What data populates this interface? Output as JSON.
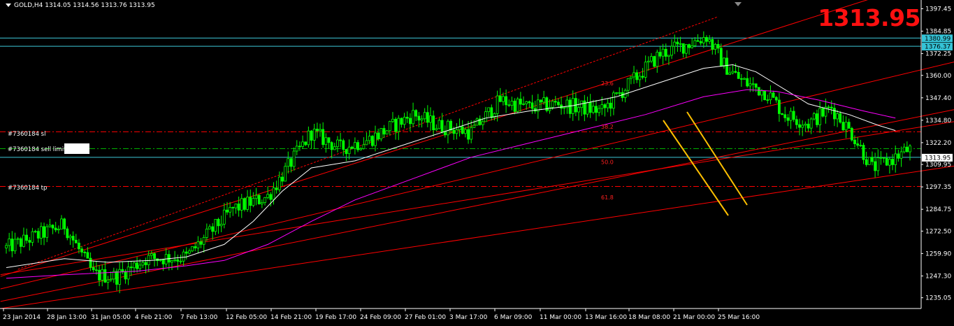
{
  "header": {
    "symbol_text": "GOLD,H4  1314.05 1314.56 1313.76 1313.95",
    "big_price": "1313.95"
  },
  "orders": {
    "sl_label": "#7360184 sl",
    "sell_limit_label": "#7360184 sell limit",
    "tp_label": "#7360184 tp"
  },
  "colors": {
    "background": "#000000",
    "candle": "#00ff00",
    "ma_fast": "#ffffff",
    "ma_slow": "#ff00ff",
    "trend": "#ff0000",
    "channel": "#ffc000",
    "hline": "#3ec8d8",
    "price": "#ff1010"
  },
  "chart_data": {
    "type": "candlestick",
    "ylim": [
      1229.0,
      1400.0
    ],
    "y_ticks": [
      "1397.45",
      "1384.85",
      "1372.25",
      "1360.00",
      "1347.40",
      "1334.80",
      "1322.20",
      "1309.95",
      "1297.35",
      "1284.75",
      "1272.50",
      "1259.90",
      "1247.30",
      "1235.05"
    ],
    "x_ticks": [
      "23 Jan 2014",
      "28 Jan 13:00",
      "31 Jan 05:00",
      "4 Feb 21:00",
      "7 Feb 13:00",
      "12 Feb 05:00",
      "14 Feb 21:00",
      "19 Feb 17:00",
      "24 Feb 09:00",
      "27 Feb 01:00",
      "3 Mar 17:00",
      "6 Mar 09:00",
      "11 Mar 00:00",
      "13 Mar 16:00",
      "18 Mar 08:00",
      "21 Mar 00:00",
      "25 Mar 16:00"
    ],
    "price_boxes": [
      {
        "label": "1380.99",
        "value": 1380.99
      },
      {
        "label": "1376.37",
        "value": 1376.37
      },
      {
        "label": "1313.95",
        "value": 1313.95
      }
    ],
    "horizontal_lines": [
      {
        "name": "upper cyan",
        "value": 1380.99,
        "style": "solid"
      },
      {
        "name": "lower cyan",
        "value": 1376.37,
        "style": "solid"
      },
      {
        "name": "current price",
        "value": 1313.95,
        "style": "solid"
      },
      {
        "name": "sl",
        "value": 1328.3,
        "style": "dashdot"
      },
      {
        "name": "sell limit",
        "value": 1318.8,
        "style": "dashdot-green"
      },
      {
        "name": "tp",
        "value": 1297.6,
        "style": "dashdot"
      }
    ],
    "fib_levels": [
      {
        "label": "23.6",
        "value": 1355.6
      },
      {
        "label": "38.2",
        "value": 1331.3
      },
      {
        "label": "50.0",
        "value": 1311.3
      },
      {
        "label": "61.8",
        "value": 1291.5
      }
    ],
    "anchors": [
      [
        0,
        1263
      ],
      [
        20,
        1276
      ],
      [
        30,
        1248
      ],
      [
        38,
        1247
      ],
      [
        48,
        1257
      ],
      [
        62,
        1258
      ],
      [
        78,
        1285
      ],
      [
        90,
        1292
      ],
      [
        105,
        1328
      ],
      [
        115,
        1319
      ],
      [
        125,
        1324
      ],
      [
        140,
        1338
      ],
      [
        148,
        1332
      ],
      [
        160,
        1328
      ],
      [
        170,
        1346
      ],
      [
        180,
        1342
      ],
      [
        190,
        1344
      ],
      [
        205,
        1340
      ],
      [
        225,
        1372
      ],
      [
        235,
        1378
      ],
      [
        241,
        1382
      ],
      [
        247,
        1366
      ],
      [
        253,
        1357
      ],
      [
        262,
        1350
      ],
      [
        268,
        1338
      ],
      [
        276,
        1333
      ],
      [
        284,
        1342
      ],
      [
        292,
        1325
      ],
      [
        298,
        1308
      ],
      [
        305,
        1313
      ],
      [
        310,
        1318
      ]
    ],
    "ma_fast": [
      [
        0,
        1252
      ],
      [
        20,
        1257
      ],
      [
        35,
        1255
      ],
      [
        50,
        1256
      ],
      [
        62,
        1258
      ],
      [
        75,
        1265
      ],
      [
        85,
        1278
      ],
      [
        95,
        1295
      ],
      [
        105,
        1308
      ],
      [
        120,
        1312
      ],
      [
        135,
        1320
      ],
      [
        150,
        1328
      ],
      [
        165,
        1336
      ],
      [
        180,
        1340
      ],
      [
        195,
        1343
      ],
      [
        210,
        1348
      ],
      [
        225,
        1356
      ],
      [
        240,
        1364
      ],
      [
        250,
        1366
      ],
      [
        258,
        1362
      ],
      [
        266,
        1354
      ],
      [
        276,
        1344
      ],
      [
        290,
        1338
      ],
      [
        300,
        1332
      ],
      [
        306,
        1329
      ]
    ],
    "ma_slow": [
      [
        0,
        1246
      ],
      [
        20,
        1248
      ],
      [
        45,
        1250
      ],
      [
        62,
        1253
      ],
      [
        75,
        1256
      ],
      [
        90,
        1265
      ],
      [
        105,
        1278
      ],
      [
        120,
        1290
      ],
      [
        140,
        1302
      ],
      [
        160,
        1314
      ],
      [
        180,
        1322
      ],
      [
        200,
        1330
      ],
      [
        220,
        1338
      ],
      [
        240,
        1348
      ],
      [
        255,
        1352
      ],
      [
        265,
        1351
      ],
      [
        280,
        1346
      ],
      [
        295,
        1340
      ],
      [
        306,
        1336
      ]
    ]
  }
}
